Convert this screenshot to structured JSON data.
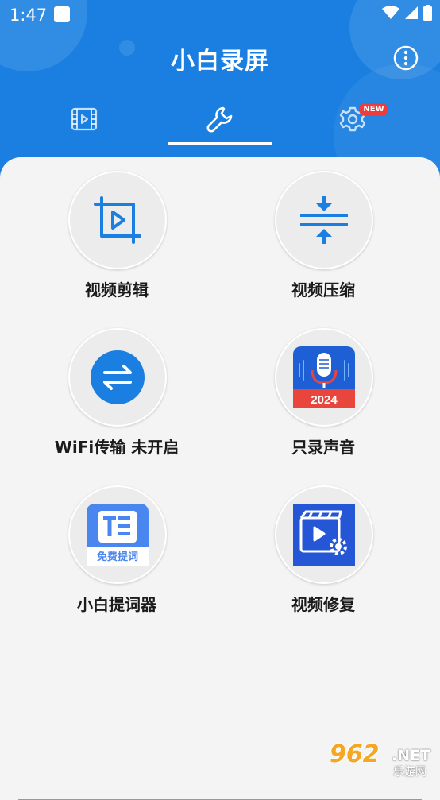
{
  "status_bar": {
    "time": "1:47"
  },
  "app": {
    "title": "小白录屏"
  },
  "tabs": [
    {
      "icon": "video-film-icon"
    },
    {
      "icon": "wrench-icon",
      "selected": true
    },
    {
      "icon": "gear-icon",
      "badge": "NEW"
    }
  ],
  "tools": [
    {
      "label": "视频剪辑",
      "icon": "crop-play-icon"
    },
    {
      "label": "视频压缩",
      "icon": "compress-arrows-icon"
    },
    {
      "label": "WiFi传输 未开启",
      "icon": "wifi-transfer-icon"
    },
    {
      "label": "只录声音",
      "icon": "microphone-icon",
      "icon_text": "2024"
    },
    {
      "label": "小白提词器",
      "icon": "teleprompter-icon",
      "icon_text": "免费提词"
    },
    {
      "label": "视频修复",
      "icon": "video-repair-icon"
    }
  ],
  "watermark": {
    "number": "962",
    "suffix": ".NET",
    "site": "乐游网"
  },
  "colors": {
    "primary": "#1a7fe0",
    "badge": "#ee3b3b",
    "mic_bg": "#1e5fd6",
    "mic_banner": "#e8453c"
  }
}
